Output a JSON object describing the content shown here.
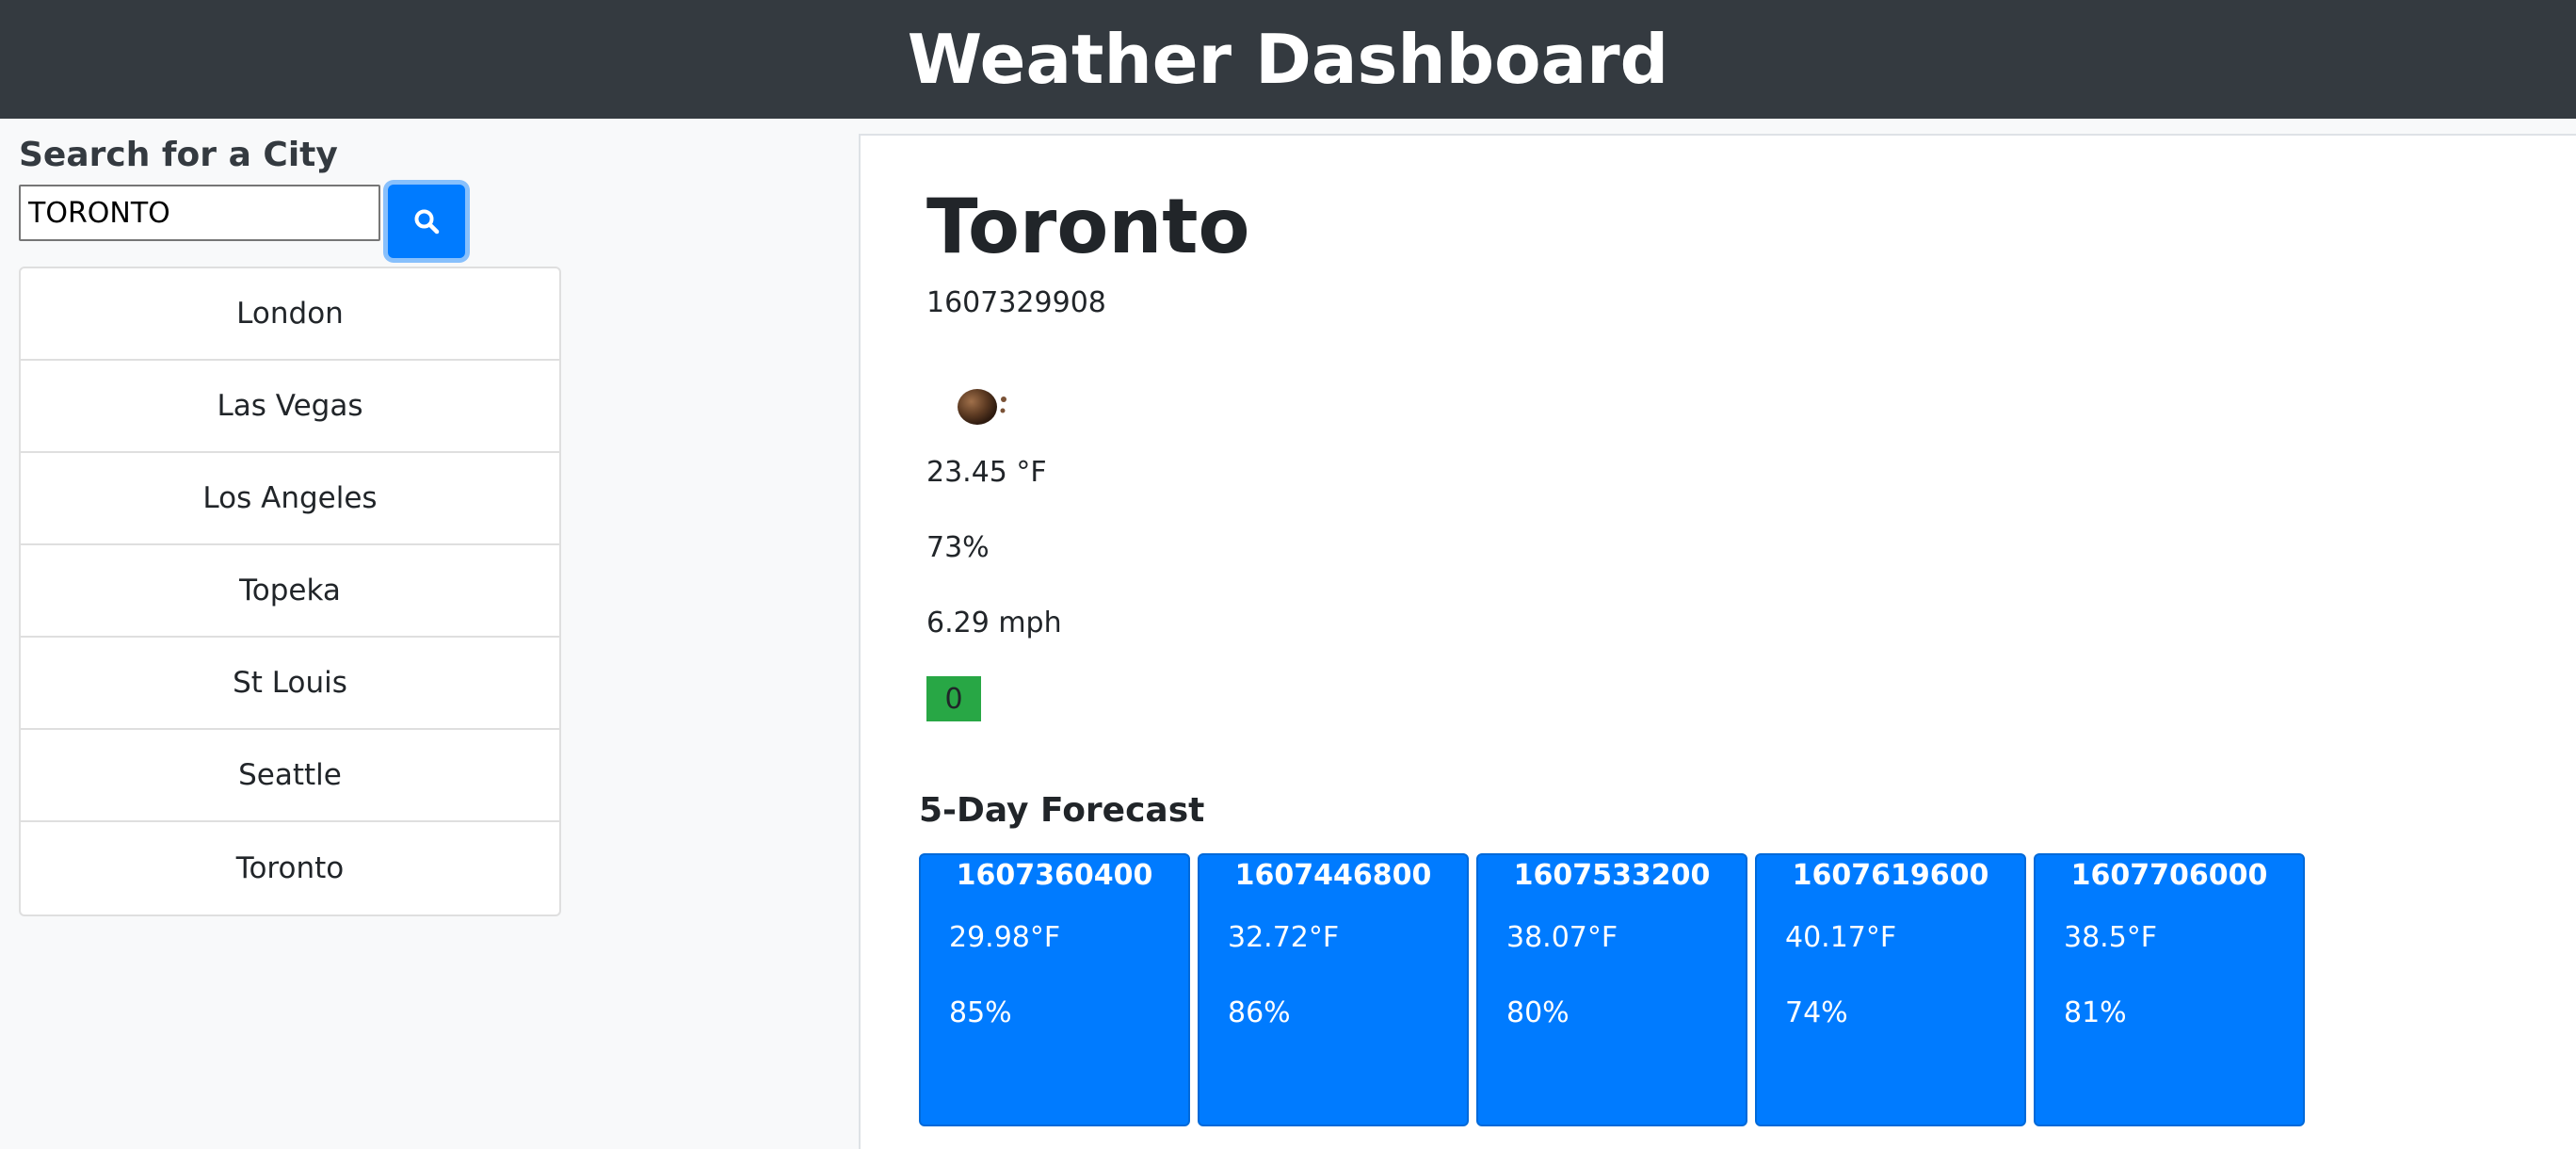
{
  "header": {
    "title": "Weather Dashboard"
  },
  "sidebar": {
    "heading": "Search for a City",
    "search_value": "TORONTO",
    "search_icon": "search-icon",
    "cities": [
      "London",
      "Las Vegas",
      "Los Angeles",
      "Topeka",
      "St Louis",
      "Seattle",
      "Toronto"
    ]
  },
  "current": {
    "city": "Toronto",
    "date": "1607329908",
    "icon": "smoke-haze-icon",
    "temperature": "23.45 °F",
    "humidity": "73%",
    "wind": "6.29 mph",
    "uv_index": "0",
    "uv_color": "#28a745"
  },
  "forecast": {
    "title": "5-Day Forecast",
    "days": [
      {
        "date": "1607360400",
        "temp": "29.98°F",
        "humidity": "85%"
      },
      {
        "date": "1607446800",
        "temp": "32.72°F",
        "humidity": "86%"
      },
      {
        "date": "1607533200",
        "temp": "38.07°F",
        "humidity": "80%"
      },
      {
        "date": "1607619600",
        "temp": "40.17°F",
        "humidity": "74%"
      },
      {
        "date": "1607706000",
        "temp": "38.5°F",
        "humidity": "81%"
      }
    ]
  },
  "colors": {
    "header_bg": "#343a40",
    "accent": "#007bff",
    "uv_good": "#28a745"
  }
}
